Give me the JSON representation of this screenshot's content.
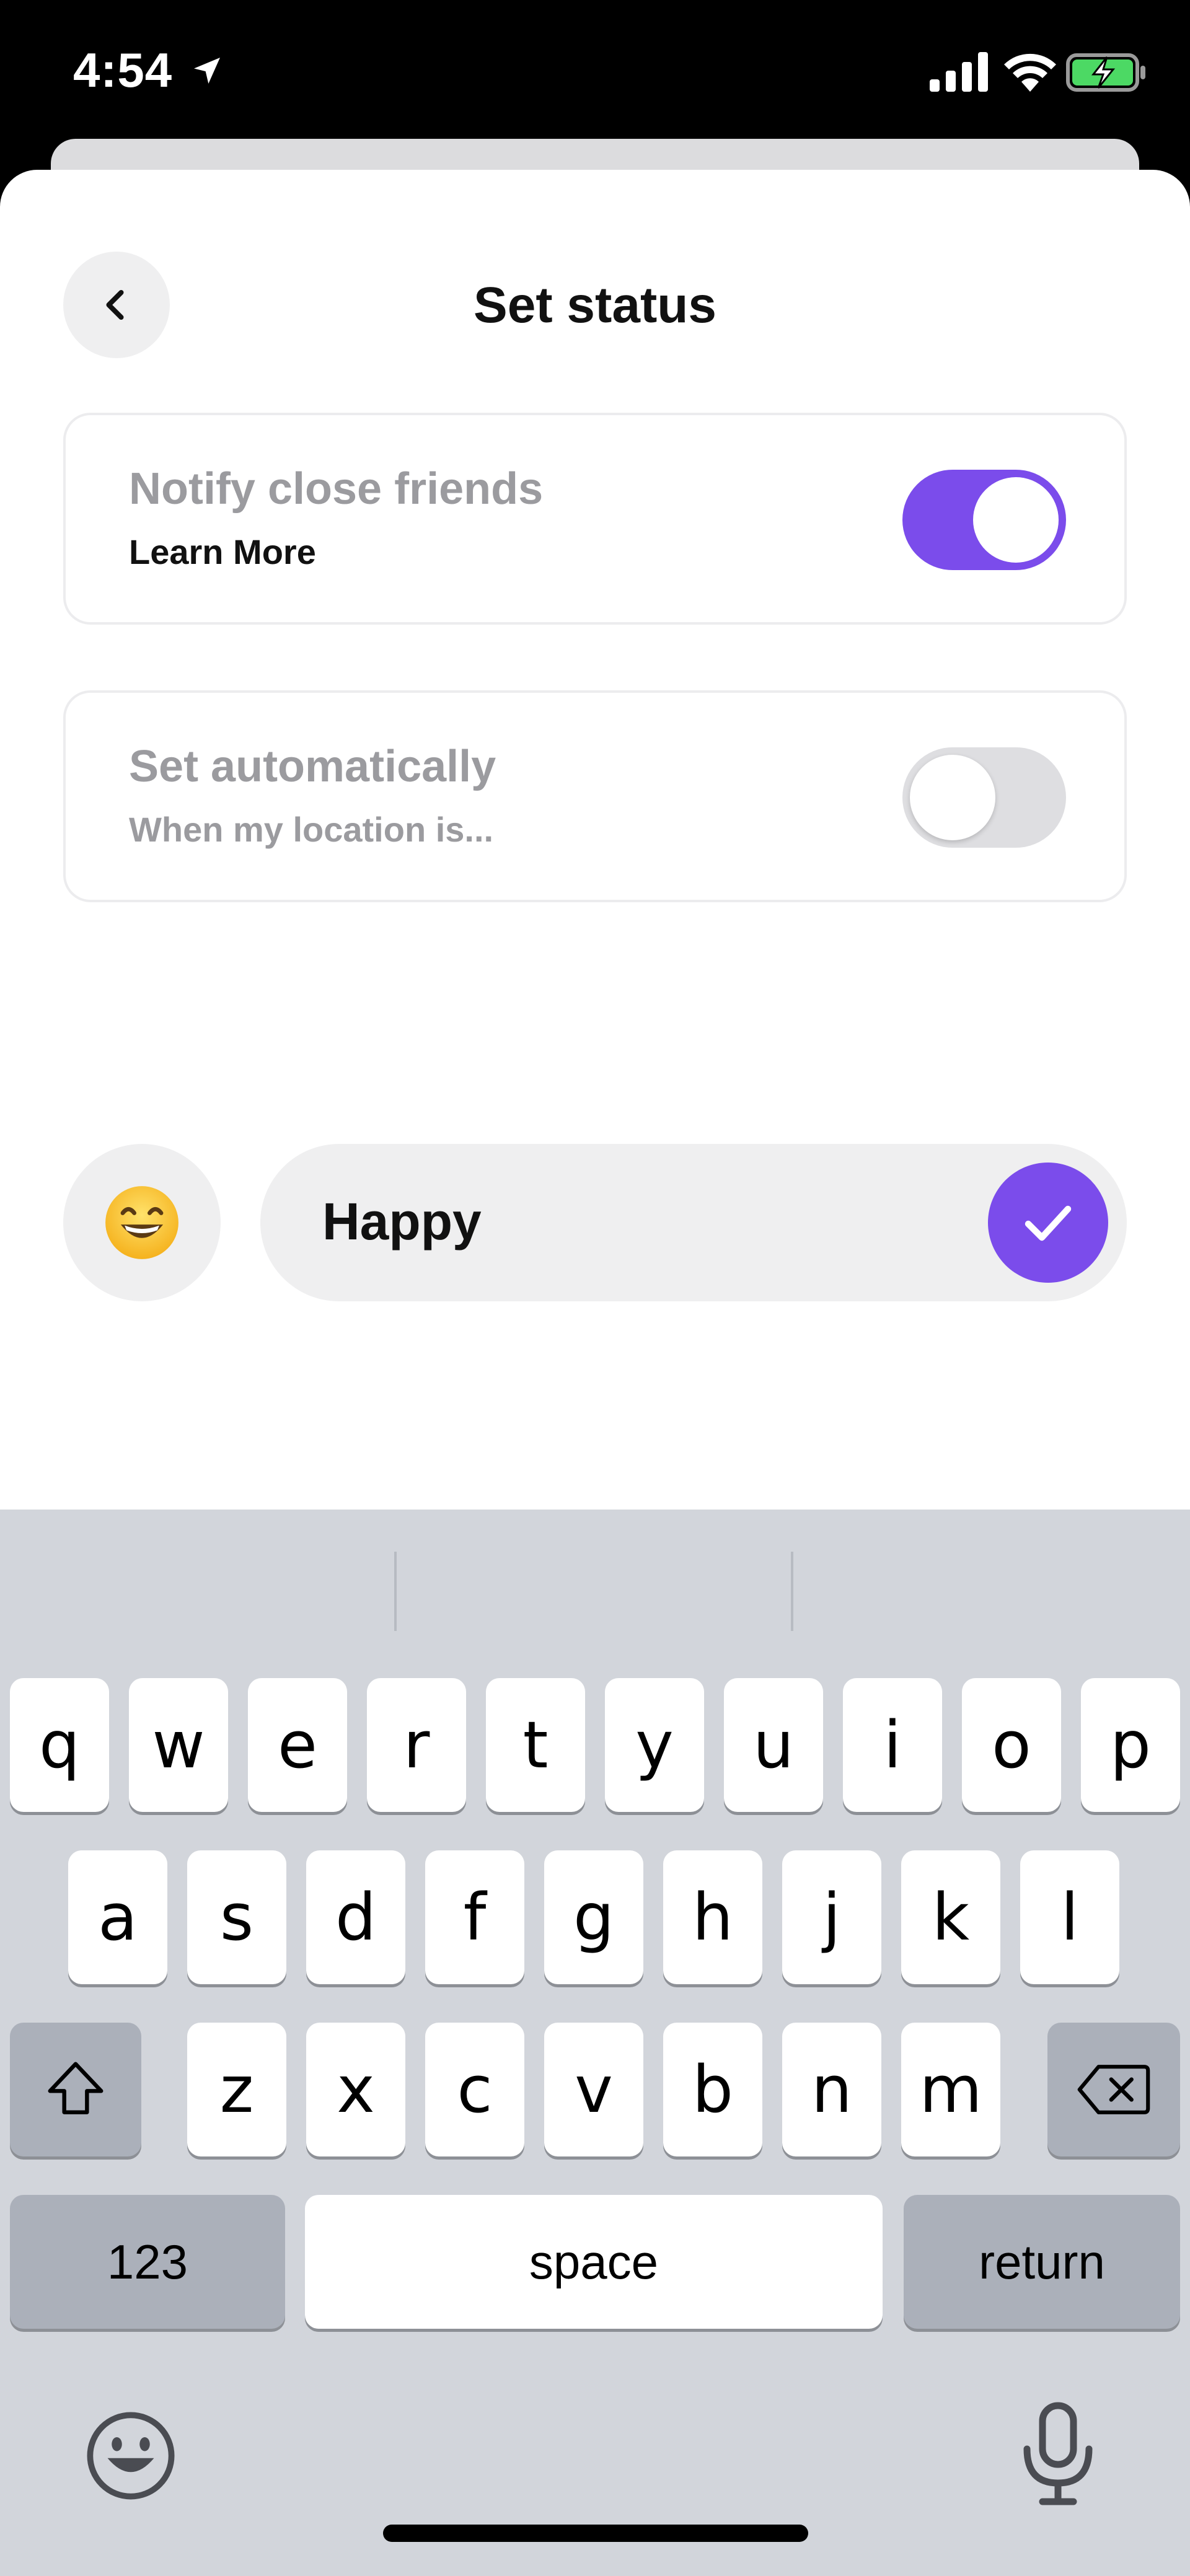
{
  "status_bar": {
    "time": "4:54",
    "icons": [
      "location-arrow-icon",
      "cellular-signal-icon",
      "wifi-icon",
      "battery-charging-icon"
    ],
    "battery_color": "#4cd964"
  },
  "header": {
    "back_icon": "chevron-left-icon",
    "title": "Set status"
  },
  "settings": [
    {
      "title": "Notify close friends",
      "subtitle": "Learn More",
      "enabled": true
    },
    {
      "title": "Set automatically",
      "subtitle": "When my location is...",
      "enabled": false
    }
  ],
  "status_input": {
    "emoji": "😄",
    "value": "Happy",
    "confirm_icon": "checkmark-icon"
  },
  "keyboard": {
    "row1": [
      "q",
      "w",
      "e",
      "r",
      "t",
      "y",
      "u",
      "i",
      "o",
      "p"
    ],
    "row2": [
      "a",
      "s",
      "d",
      "f",
      "g",
      "h",
      "j",
      "k",
      "l"
    ],
    "row3": [
      "z",
      "x",
      "c",
      "v",
      "b",
      "n",
      "m"
    ],
    "shift_icon": "shift-icon",
    "delete_icon": "backspace-icon",
    "numbers_label": "123",
    "space_label": "space",
    "return_label": "return",
    "emoji_icon": "emoji-keyboard-icon",
    "mic_icon": "microphone-icon"
  },
  "colors": {
    "accent": "#7b4ceb",
    "keyboard_bg": "#d2d5db",
    "card_title": "#9b9b9f"
  }
}
